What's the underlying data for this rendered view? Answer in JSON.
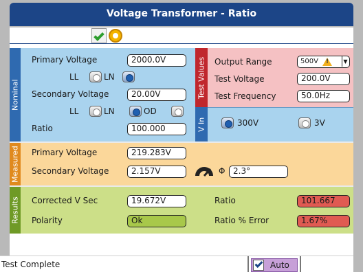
{
  "window": {
    "title": "Voltage Transformer - Ratio"
  },
  "sections": {
    "nominal": "Nominal",
    "test_values": "Test Values",
    "v_in": "V In",
    "measured": "Measured",
    "results": "Results"
  },
  "nominal": {
    "primary_voltage_label": "Primary Voltage",
    "primary_voltage_value": "2000.0V",
    "primary_ll_label": "LL",
    "primary_ln_label": "LN",
    "secondary_voltage_label": "Secondary Voltage",
    "secondary_voltage_value": "20.00V",
    "secondary_ll_label": "LL",
    "secondary_ln_label": "LN",
    "secondary_od_label": "OD",
    "ratio_label": "Ratio",
    "ratio_value": "100.000"
  },
  "test_values": {
    "output_range_label": "Output Range",
    "output_range_value": "500V",
    "test_voltage_label": "Test Voltage",
    "test_voltage_value": "200.0V",
    "test_frequency_label": "Test Frequency",
    "test_frequency_value": "50.0Hz"
  },
  "v_in": {
    "option_300": "300V",
    "option_3": "3V"
  },
  "measured": {
    "primary_voltage_label": "Primary Voltage",
    "primary_voltage_value": "219.283V",
    "secondary_voltage_label": "Secondary Voltage",
    "secondary_voltage_value": "2.157V",
    "phase_symbol": "Φ",
    "phase_value": "2.3°"
  },
  "results": {
    "corrected_v_sec_label": "Corrected V Sec",
    "corrected_v_sec_value": "19.672V",
    "polarity_label": "Polarity",
    "polarity_value": "Ok",
    "ratio_label": "Ratio",
    "ratio_value": "101.667",
    "ratio_error_label": "Ratio % Error",
    "ratio_error_value": "1.67%"
  },
  "status": {
    "message": "Test Complete",
    "auto_label": "Auto"
  },
  "colors": {
    "title_bar": "#1c4587",
    "nominal_bg": "#a9d3ee",
    "test_values_bg": "#f5c1c3",
    "measured_bg": "#fbd79a",
    "results_bg": "#ccdf88",
    "pass_field": "#a8c84a",
    "fail_field": "#e05a52"
  },
  "icons": {
    "toolbar": [
      "checkmark-icon",
      "help-icon"
    ],
    "measured": "phase-gauge-icon",
    "output_range": "warning-icon"
  }
}
